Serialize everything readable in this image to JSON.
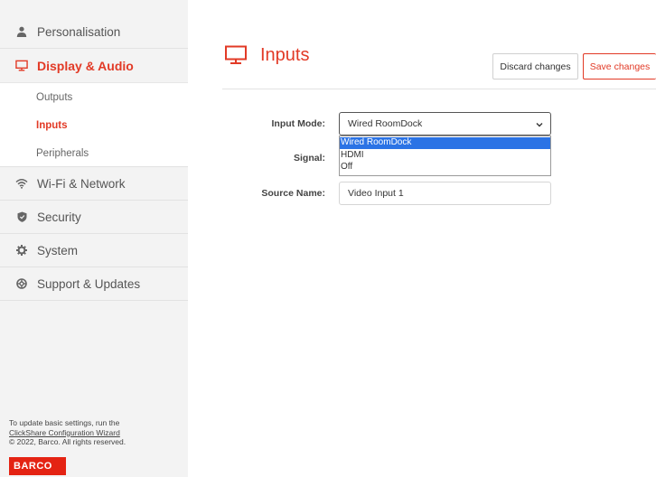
{
  "sidebar": {
    "items": [
      {
        "label": "Personalisation",
        "icon": "user-icon"
      },
      {
        "label": "Display & Audio",
        "icon": "monitor-icon"
      },
      {
        "label": "Wi-Fi & Network",
        "icon": "wifi-icon"
      },
      {
        "label": "Security",
        "icon": "shield-icon"
      },
      {
        "label": "System",
        "icon": "gear-icon"
      },
      {
        "label": "Support & Updates",
        "icon": "lifebuoy-icon"
      }
    ],
    "subitems": [
      {
        "label": "Outputs"
      },
      {
        "label": "Inputs"
      },
      {
        "label": "Peripherals"
      }
    ],
    "footer": {
      "line1": "To update basic settings, run the",
      "link": "ClickShare Configuration Wizard",
      "copyright": "© 2022, Barco. All rights reserved.",
      "logo": "BARCO"
    }
  },
  "header": {
    "title": "Inputs",
    "discard_label": "Discard changes",
    "save_label": "Save changes"
  },
  "form": {
    "input_mode_label": "Input Mode:",
    "input_mode_value": "Wired RoomDock",
    "input_mode_options": [
      "Wired RoomDock",
      "HDMI",
      "Off"
    ],
    "signal_label": "Signal:",
    "source_name_label": "Source Name:",
    "source_name_value": "Video Input 1"
  },
  "colors": {
    "accent": "#e23a26",
    "selected_option": "#2b73e5",
    "sidebar_bg": "#f3f3f3"
  }
}
